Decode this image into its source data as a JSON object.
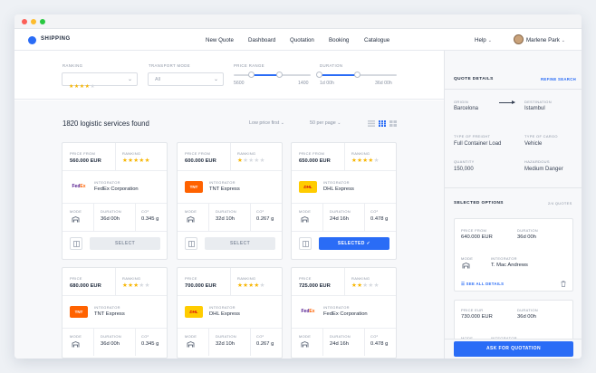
{
  "nav": {
    "brand": "SHIPPING",
    "links": [
      "New Quote",
      "Dashboard",
      "Quotation",
      "Booking",
      "Catalogue"
    ],
    "help": "Help",
    "user": "Marlene Park"
  },
  "filters": {
    "ranking_label": "RANKING",
    "ranking_value": 4,
    "transport_label": "TRANSPORT MODE",
    "transport_value": "All",
    "price_label": "PRICE RANGE",
    "price_min": "5600",
    "price_max": "1400",
    "duration_label": "DURATION",
    "duration_min": "1d 00h",
    "duration_max": "36d 00h"
  },
  "results": {
    "count_text": "1820 logistic services found",
    "sort": "Low price first",
    "per_page": "50 per page"
  },
  "cards": [
    {
      "price_label": "PRICE FROM",
      "price": "560.000 EUR",
      "ranking_label": "RANKING",
      "stars": 5,
      "integrator_label": "INTEGRATOR",
      "integrator": "FedEx Corporation",
      "brand": "fedex",
      "mode_label": "MODE",
      "duration_label": "DURATION",
      "duration": "36d 00h",
      "co2_label": "CO²",
      "co2": "0.345 g",
      "button": "SELECT",
      "selected": false
    },
    {
      "price_label": "PRICE FROM",
      "price": "600.000 EUR",
      "ranking_label": "RANKING",
      "stars": 1,
      "integrator_label": "INTEGRATOR",
      "integrator": "TNT Express",
      "brand": "tnt",
      "mode_label": "MODE",
      "duration_label": "DURATION",
      "duration": "32d 10h",
      "co2_label": "CO²",
      "co2": "0.267 g",
      "button": "SELECT",
      "selected": false
    },
    {
      "price_label": "PRICE FROM",
      "price": "650.000 EUR",
      "ranking_label": "RANKING",
      "stars": 4,
      "integrator_label": "INTEGRATOR",
      "integrator": "DHL Express",
      "brand": "dhl",
      "mode_label": "MODE",
      "duration_label": "DURATION",
      "duration": "24d 16h",
      "co2_label": "CO²",
      "co2": "0.478 g",
      "button": "SELECTED",
      "selected": true
    },
    {
      "price_label": "PRICE",
      "price": "680.000 EUR",
      "ranking_label": "RANKING",
      "stars": 3,
      "integrator_label": "INTEGRATOR",
      "integrator": "TNT Express",
      "brand": "tnt",
      "mode_label": "MODE",
      "duration_label": "DURATION",
      "duration": "36d 00h",
      "co2_label": "CO²",
      "co2": "0.345 g"
    },
    {
      "price_label": "PRICE",
      "price": "700.000 EUR",
      "ranking_label": "RANKING",
      "stars": 4,
      "integrator_label": "INTEGRATOR",
      "integrator": "DHL Express",
      "brand": "dhl",
      "mode_label": "MODE",
      "duration_label": "DURATION",
      "duration": "32d 10h",
      "co2_label": "CO²",
      "co2": "0.267 g"
    },
    {
      "price_label": "PRICE",
      "price": "725.000 EUR",
      "ranking_label": "RANKING",
      "stars": 2,
      "integrator_label": "INTEGRATOR",
      "integrator": "FedEx Corporation",
      "brand": "fedex",
      "mode_label": "MODE",
      "duration_label": "DURATION",
      "duration": "24d 16h",
      "co2_label": "CO²",
      "co2": "0.478 g"
    }
  ],
  "quote": {
    "title": "QUOTE DETAILS",
    "refine": "REFINE SEARCH",
    "origin_label": "ORIGIN",
    "origin": "Barcelona",
    "destination_label": "DESTINATION",
    "destination": "Istambul",
    "freight_label": "TYPE OF FREIGHT",
    "freight": "Full Container Load",
    "cargo_label": "TYPE OF CARGO",
    "cargo": "Vehicle",
    "quantity_label": "QUANTITY",
    "quantity": "150,000",
    "hazard_label": "HAZARDOUS",
    "hazard": "Medium Danger",
    "selected_title": "SELECTED OPTIONS",
    "selected_count": "2/4 QUOTES",
    "options": [
      {
        "price_label": "PRICE FROM",
        "price": "640.000 EUR",
        "duration_label": "DURATION",
        "duration": "36d 00h",
        "mode_label": "MODE",
        "integrator_label": "INTEGRATOR",
        "integrator": "T. Mac Andrews",
        "see_all": "SEE ALL DETAILS"
      },
      {
        "price_label": "PRICE EUR",
        "price": "730.000 EUR",
        "duration_label": "DURATION",
        "duration": "36d 00h",
        "mode_label": "MODE",
        "integrator_label": "INTEGRATOR"
      }
    ],
    "ask_button": "ASK FOR QUOTATION"
  },
  "colors": {
    "accent": "#2a6cf6",
    "star": "#f7b500",
    "tnt": "#ff6200",
    "dhl": "#ffcc00"
  }
}
